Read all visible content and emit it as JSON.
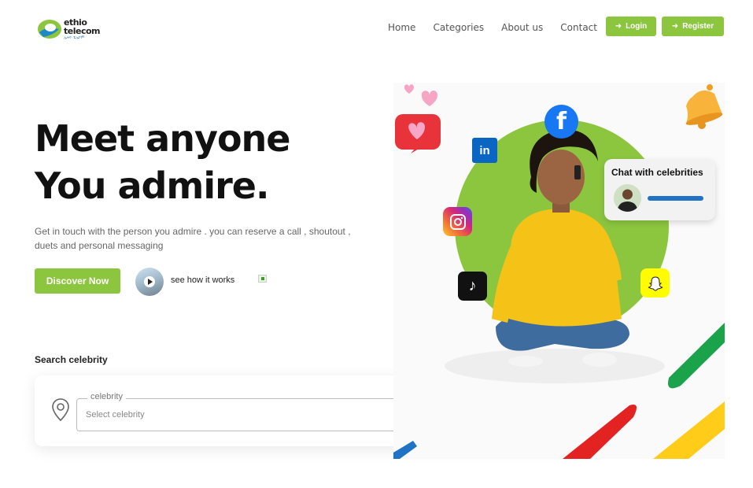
{
  "header": {
    "logo_name": "ethio telecom",
    "logo_sub": "ኢትዮ ቴሌኮም",
    "nav": [
      "Home",
      "Categories",
      "About us",
      "Contact"
    ],
    "login_label": "Login",
    "register_label": "Register"
  },
  "hero": {
    "title_line1": "Meet anyone",
    "title_line2": "You admire.",
    "description": "Get in touch with the person you admire . you can reserve a call , shoutout , duets and personal messaging",
    "discover_label": "Discover Now",
    "see_how_label": "see how it works"
  },
  "search": {
    "label": "Search celebrity",
    "legend": "celebrity",
    "placeholder": "Select celebrity"
  },
  "visual": {
    "chat_title": "Chat with celebrities"
  },
  "colors": {
    "brand_green": "#8cc63f",
    "search_purple": "#5b3fd6",
    "chat_bar_blue": "#1f72c4"
  }
}
